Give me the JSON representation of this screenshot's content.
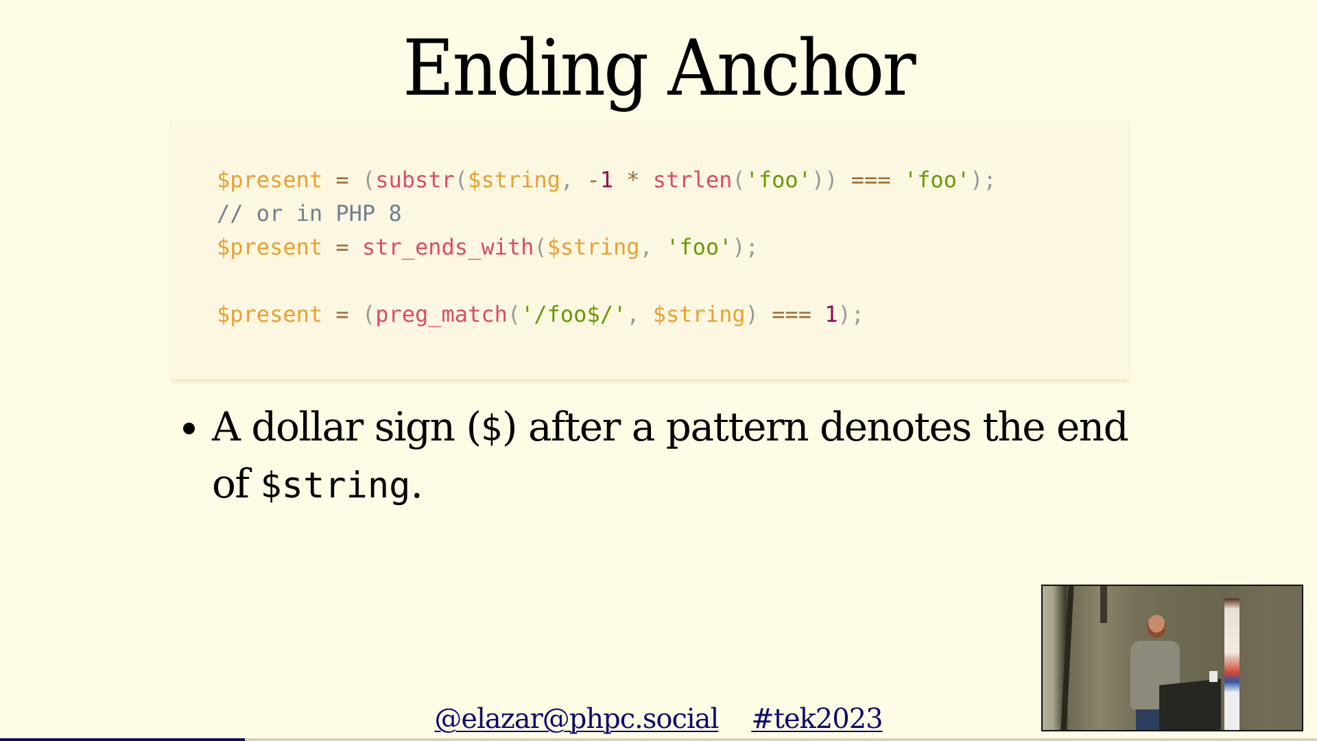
{
  "slide": {
    "title": "Ending Anchor",
    "background_color": "#fefce4",
    "code": {
      "language": "php",
      "lines": [
        [
          {
            "type": "variable",
            "text": "$present"
          },
          {
            "type": "plain",
            "text": " "
          },
          {
            "type": "operator",
            "text": "="
          },
          {
            "type": "plain",
            "text": " "
          },
          {
            "type": "punct",
            "text": "("
          },
          {
            "type": "function",
            "text": "substr"
          },
          {
            "type": "punct",
            "text": "("
          },
          {
            "type": "variable",
            "text": "$string"
          },
          {
            "type": "punct",
            "text": ","
          },
          {
            "type": "plain",
            "text": " "
          },
          {
            "type": "operator",
            "text": "-"
          },
          {
            "type": "number",
            "text": "1"
          },
          {
            "type": "plain",
            "text": " "
          },
          {
            "type": "operator",
            "text": "*"
          },
          {
            "type": "plain",
            "text": " "
          },
          {
            "type": "function",
            "text": "strlen"
          },
          {
            "type": "punct",
            "text": "("
          },
          {
            "type": "string",
            "text": "'foo'"
          },
          {
            "type": "punct",
            "text": "))"
          },
          {
            "type": "plain",
            "text": " "
          },
          {
            "type": "operator",
            "text": "==="
          },
          {
            "type": "plain",
            "text": " "
          },
          {
            "type": "string",
            "text": "'foo'"
          },
          {
            "type": "punct",
            "text": ");"
          }
        ],
        [
          {
            "type": "comment",
            "text": "// or in PHP 8"
          }
        ],
        [
          {
            "type": "variable",
            "text": "$present"
          },
          {
            "type": "plain",
            "text": " "
          },
          {
            "type": "operator",
            "text": "="
          },
          {
            "type": "plain",
            "text": " "
          },
          {
            "type": "function",
            "text": "str_ends_with"
          },
          {
            "type": "punct",
            "text": "("
          },
          {
            "type": "variable",
            "text": "$string"
          },
          {
            "type": "punct",
            "text": ","
          },
          {
            "type": "plain",
            "text": " "
          },
          {
            "type": "string",
            "text": "'foo'"
          },
          {
            "type": "punct",
            "text": ");"
          }
        ],
        [],
        [
          {
            "type": "variable",
            "text": "$present"
          },
          {
            "type": "plain",
            "text": " "
          },
          {
            "type": "operator",
            "text": "="
          },
          {
            "type": "plain",
            "text": " "
          },
          {
            "type": "punct",
            "text": "("
          },
          {
            "type": "function",
            "text": "preg_match"
          },
          {
            "type": "punct",
            "text": "("
          },
          {
            "type": "string",
            "text": "'/foo$/'"
          },
          {
            "type": "punct",
            "text": ","
          },
          {
            "type": "plain",
            "text": " "
          },
          {
            "type": "variable",
            "text": "$string"
          },
          {
            "type": "punct",
            "text": ")"
          },
          {
            "type": "plain",
            "text": " "
          },
          {
            "type": "operator",
            "text": "==="
          },
          {
            "type": "plain",
            "text": " "
          },
          {
            "type": "number",
            "text": "1"
          },
          {
            "type": "punct",
            "text": ");"
          }
        ]
      ],
      "token_colors": {
        "variable": "#e9a02f",
        "operator": "#9a6e3a",
        "punct": "#999999",
        "function": "#dd4a68",
        "number": "#990055",
        "string": "#669900",
        "comment": "#708090"
      }
    },
    "bullets": [
      {
        "part1": "A dollar sign (",
        "code1": "$",
        "part2": ") after a pattern denotes the end of ",
        "code2": "$string",
        "part3": "."
      }
    ]
  },
  "footer": {
    "handle": "@elazar@phpc.social",
    "hashtag": "#tek2023",
    "link_color": "#0b0b6e"
  },
  "webcam": {
    "label": "speaker-video-feed"
  },
  "progress": {
    "fraction": 0.186,
    "fill_color": "#0b0b6e",
    "track_color": "#d8d0b8"
  }
}
